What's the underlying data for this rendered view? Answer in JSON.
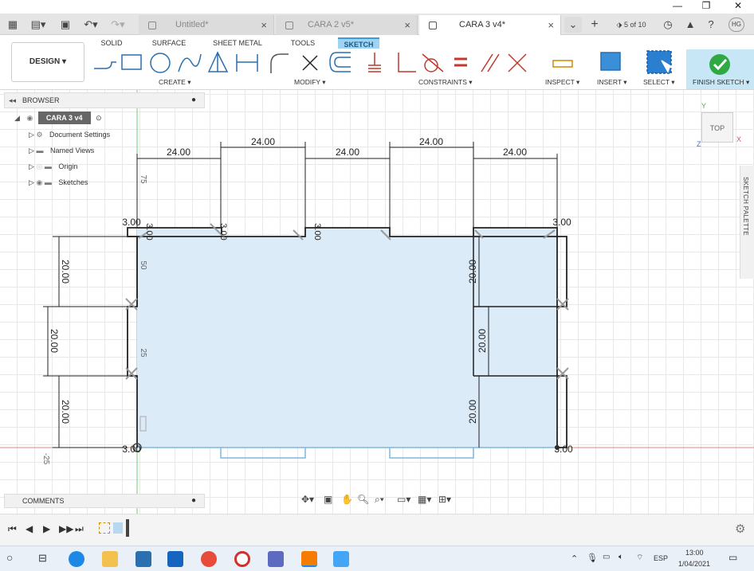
{
  "window": {
    "minimize": "—",
    "restore": "❐",
    "close": "✕"
  },
  "tabs": [
    {
      "label": "Untitled*",
      "active": false
    },
    {
      "label": "CARA 2 v5*",
      "active": false
    },
    {
      "label": "CARA 3 v4*",
      "active": true
    }
  ],
  "top_right": {
    "version": "5 of 10",
    "user": "HG"
  },
  "workspace_tabs": [
    "SOLID",
    "SURFACE",
    "SHEET METAL",
    "TOOLS",
    "SKETCH"
  ],
  "design_button": "DESIGN ▾",
  "groups": {
    "create": "CREATE ▾",
    "modify": "MODIFY ▾",
    "constraints": "CONSTRAINTS ▾",
    "inspect": "INSPECT ▾",
    "insert": "INSERT ▾",
    "select": "SELECT ▾",
    "finish": "FINISH SKETCH ▾"
  },
  "browser": {
    "title": "BROWSER",
    "component": "CARA 3 v4",
    "items": [
      "Document Settings",
      "Named Views",
      "Origin",
      "Sketches"
    ]
  },
  "comments": "COMMENTS",
  "viewcube": {
    "face": "TOP",
    "axis_y": "Y",
    "axis_x": "X",
    "axis_z": "Z"
  },
  "palette": "SKETCH PALETTE",
  "dimensions": {
    "top": [
      "24.00",
      "24.00",
      "24.00",
      "24.00",
      "24.00"
    ],
    "left_vertical": [
      "20.00",
      "20.00",
      "20.00"
    ],
    "right_vertical": [
      "20.00",
      "20.00",
      "20.00"
    ],
    "small": [
      "3.00",
      "3.00",
      "3.00",
      "3.00",
      "3.00",
      "3.00",
      "3.00"
    ],
    "ruler_left": [
      "75",
      "50",
      "25",
      "-25"
    ]
  },
  "colors": {
    "accent": "#3a9cd8",
    "sketch_fill": "#dcebf8",
    "finish_green": "#2ea944",
    "profile_line": "#222222",
    "construction_blue": "#7fb8e0"
  },
  "taskbar": {
    "lang": "ESP",
    "time": "13:00",
    "date": "1/04/2021"
  }
}
